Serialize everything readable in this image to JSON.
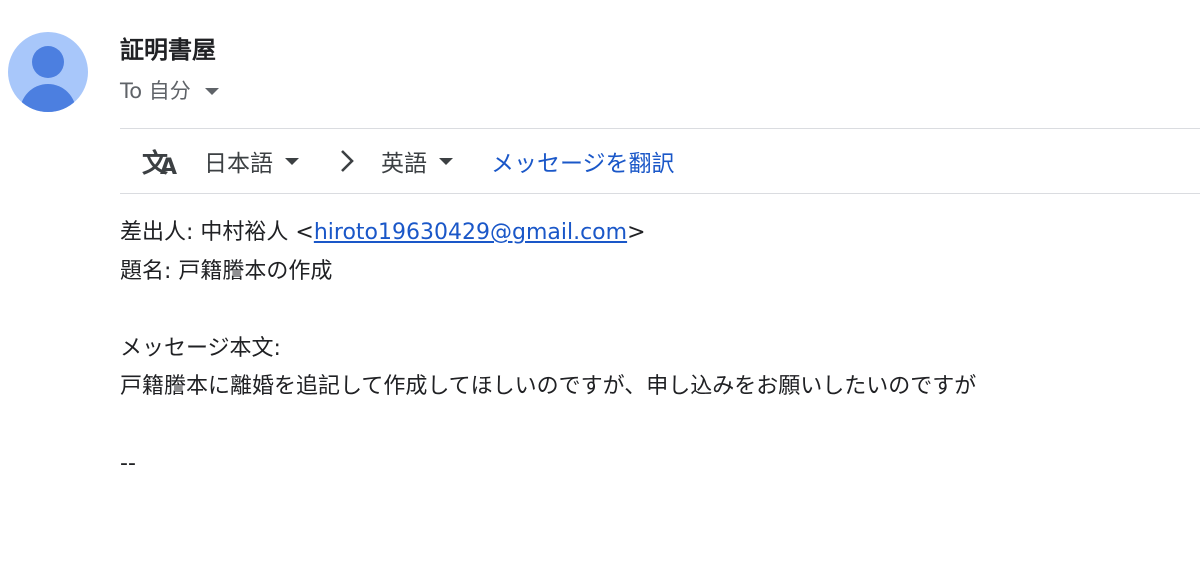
{
  "header": {
    "sender_name": "証明書屋",
    "to_label": "To 自分"
  },
  "translate_bar": {
    "source_language": "日本語",
    "target_language": "英語",
    "translate_link": "メッセージを翻訳"
  },
  "message": {
    "from_label": "差出人: 中村裕人 <",
    "from_email": "hiroto19630429@gmail.com",
    "from_suffix": ">",
    "subject_line": "題名: 戸籍謄本の作成",
    "body_label": "メッセージ本文:",
    "body_text": "戸籍謄本に離婚を追記して作成してほしいのですが、申し込みをお願いしたいのですが",
    "signature": "--"
  },
  "colors": {
    "avatar_bg": "#a8c7fa",
    "avatar_fg": "#4c7fe0",
    "link": "#1a57c8"
  }
}
